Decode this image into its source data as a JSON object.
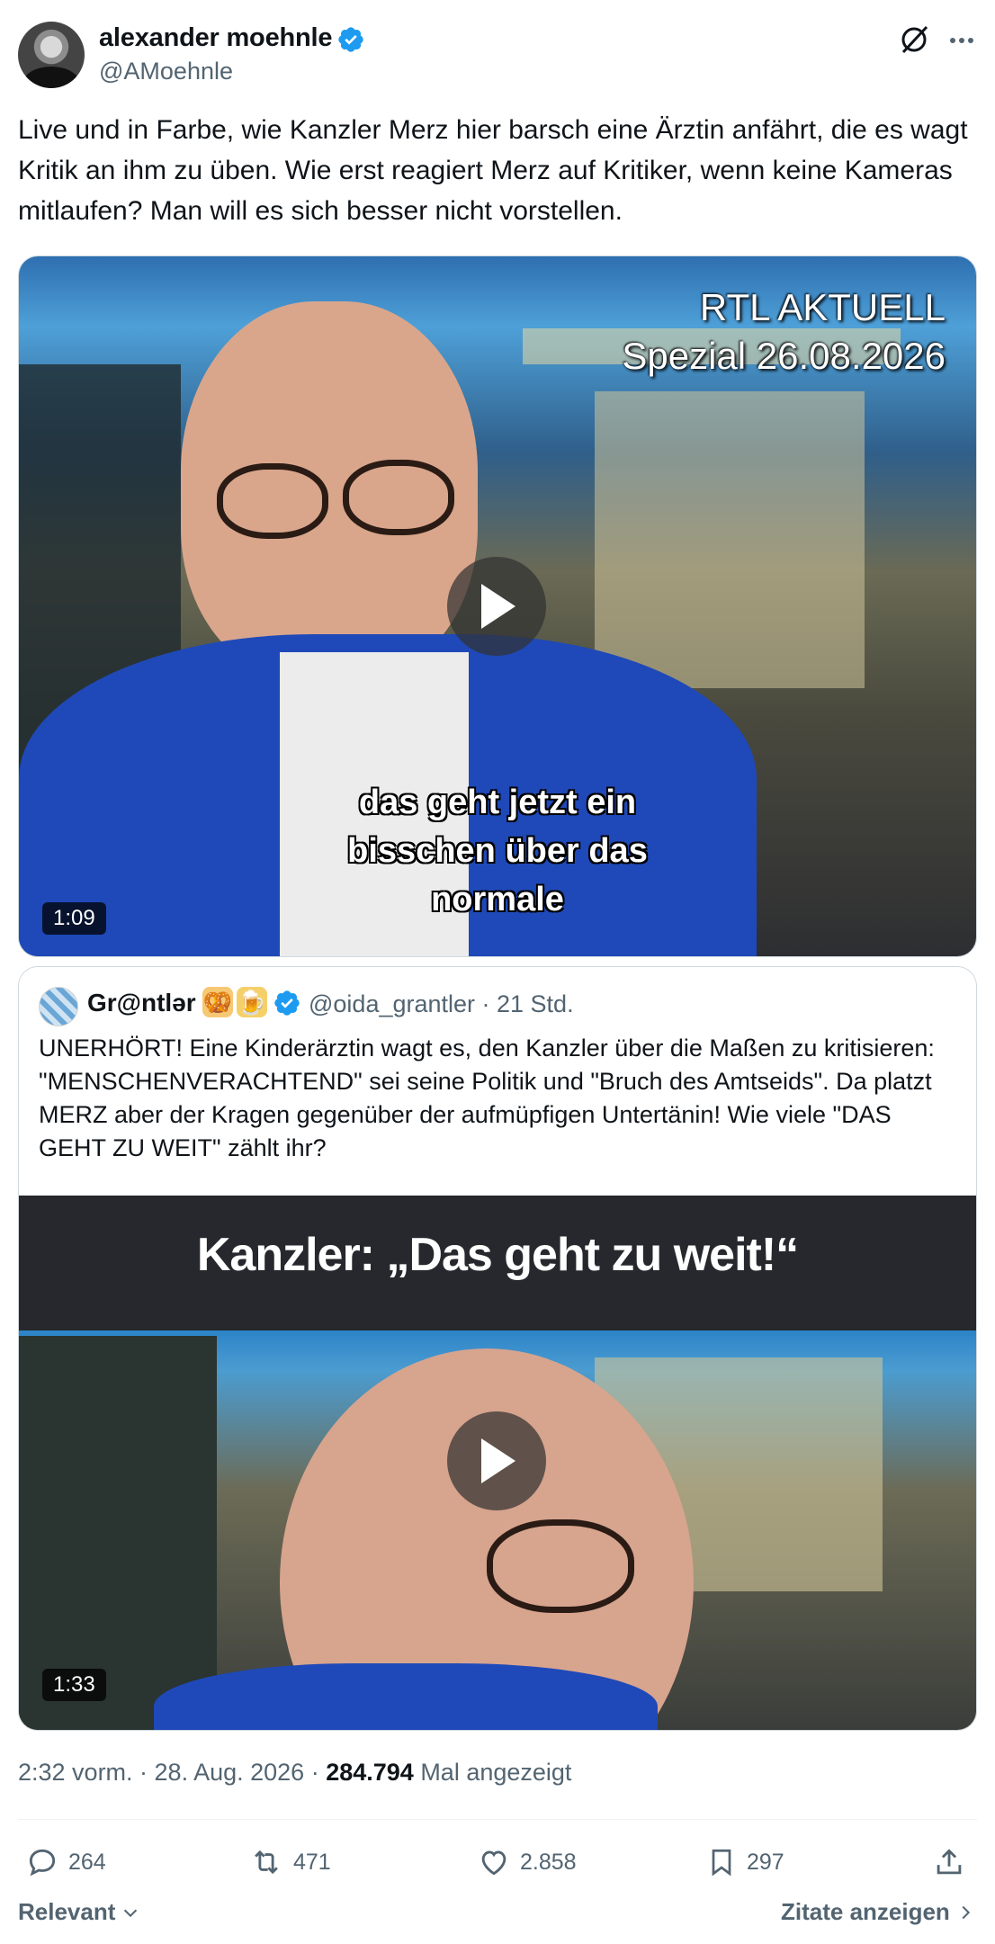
{
  "author": {
    "name": "alexander moehnle",
    "handle": "@AMoehnle"
  },
  "post": {
    "text": "Live und in Farbe, wie Kanzler Merz hier barsch eine Ärztin anfährt, die es wagt Kritik an ihm zu üben. Wie erst reagiert Merz auf Kritiker, wenn keine Kameras mitlaufen? Man will es sich besser nicht vorstellen."
  },
  "video1": {
    "overlay_line1": "RTL AKTUELL",
    "overlay_line2": "Spezial 26.08.2026",
    "subtitle": "das geht jetzt ein bisschen über das normale",
    "duration": "1:09"
  },
  "quoted": {
    "name": "Gr@ntlər",
    "emoji1": "🥨",
    "emoji2": "🍺",
    "handle_time": "@oida_grantler · 21 Std.",
    "text": "UNERHÖRT! Eine Kinderärztin wagt es, den Kanzler über die Maßen zu kritisieren: \"MENSCHENVERACHTEND\" sei seine Politik und \"Bruch des Amtseids\". Da platzt MERZ aber der Kragen gegenüber der aufmüpfigen Untertänin! Wie viele \"DAS GEHT ZU WEIT\" zählt ihr?",
    "video": {
      "banner": "Kanzler: „Das geht zu weit!“",
      "duration": "1:33"
    }
  },
  "meta": {
    "time_date": "2:32 vorm. · 28. Aug. 2026 · ",
    "views": "284.794",
    "views_label": " Mal angezeigt"
  },
  "actions": {
    "replies": "264",
    "reposts": "471",
    "likes": "2.858",
    "bookmarks": "297"
  },
  "footer": {
    "sort_label": "Relevant",
    "quotes_label": "Zitate anzeigen"
  },
  "colors": {
    "verified": "#1d9bf0",
    "text": "#0f1419",
    "secondary": "#536471"
  }
}
